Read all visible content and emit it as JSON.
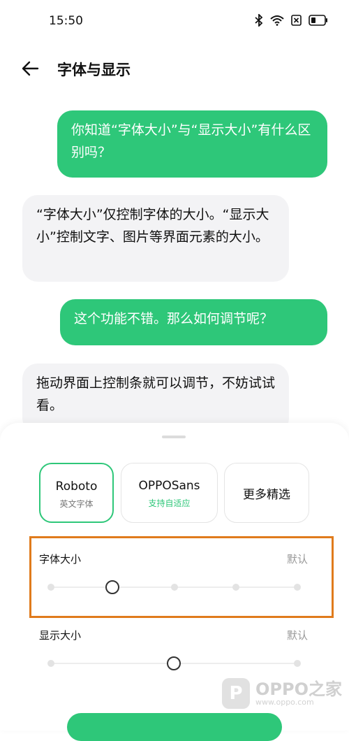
{
  "status_bar": {
    "time": "15:50",
    "icons": [
      "bluetooth-icon",
      "wifi-icon",
      "sim-off-icon",
      "battery-icon"
    ]
  },
  "header": {
    "back_icon": "arrow-left-icon",
    "title": "字体与显示"
  },
  "chat": {
    "messages": [
      {
        "side": "right",
        "text": "你知道“字体大小”与“显示大小”有什么区别吗？"
      },
      {
        "side": "left",
        "text": "“字体大小”仅控制字体的大小。“显示大小”控制文字、图片等界面元素的大小。"
      },
      {
        "side": "right",
        "text": "这个功能不错。那么如何调节呢？"
      },
      {
        "side": "left",
        "text": "拖动界面上控制条就可以调节，不妨试试看。"
      }
    ]
  },
  "fonts": [
    {
      "name": "Roboto",
      "subtitle": "英文字体",
      "selected": true
    },
    {
      "name": "OPPOSans",
      "subtitle": "支持自适应",
      "selected": false
    },
    {
      "name": "更多精选",
      "subtitle": "",
      "selected": false
    }
  ],
  "font_size": {
    "label": "字体大小",
    "value_label": "默认",
    "steps": 5,
    "selected_index": 1
  },
  "display_size": {
    "label": "显示大小",
    "value_label": "默认",
    "steps": 3,
    "selected_index": 1
  },
  "watermark": {
    "brand": "OPPO之家",
    "url": "www.oppo.com",
    "logo_letter": "P"
  },
  "colors": {
    "accent": "#2ec779",
    "highlight": "#e07b1c"
  }
}
